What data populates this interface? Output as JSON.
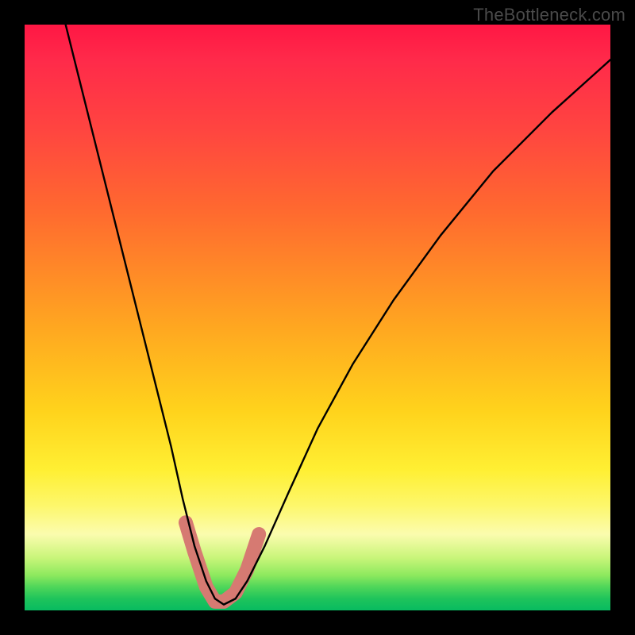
{
  "watermark": "TheBottleneck.com",
  "chart_data": {
    "type": "line",
    "title": "",
    "xlabel": "",
    "ylabel": "",
    "xlim": [
      0,
      100
    ],
    "ylim": [
      0,
      100
    ],
    "series": [
      {
        "name": "bottleneck-curve",
        "x": [
          7,
          10,
          13,
          16,
          19,
          22,
          25,
          27,
          29,
          31,
          32.5,
          34,
          36,
          38,
          41,
          45,
          50,
          56,
          63,
          71,
          80,
          90,
          100
        ],
        "values": [
          100,
          88,
          76,
          64,
          52,
          40,
          28,
          19,
          11,
          5,
          2,
          1,
          2,
          5,
          11,
          20,
          31,
          42,
          53,
          64,
          75,
          85,
          94
        ]
      }
    ],
    "markers": {
      "name": "highlight-band",
      "color": "#d67a72",
      "x": [
        27.5,
        29,
        31,
        32.5,
        34,
        36,
        38,
        40
      ],
      "values": [
        15,
        10,
        4,
        1.5,
        1.5,
        3,
        7,
        13
      ]
    },
    "gradient_stops": [
      {
        "pos": 0,
        "color": "#ff1744"
      },
      {
        "pos": 18,
        "color": "#ff4540"
      },
      {
        "pos": 52,
        "color": "#ffa820"
      },
      {
        "pos": 76,
        "color": "#ffef33"
      },
      {
        "pos": 91,
        "color": "#8de95e"
      },
      {
        "pos": 100,
        "color": "#08bb60"
      }
    ]
  }
}
